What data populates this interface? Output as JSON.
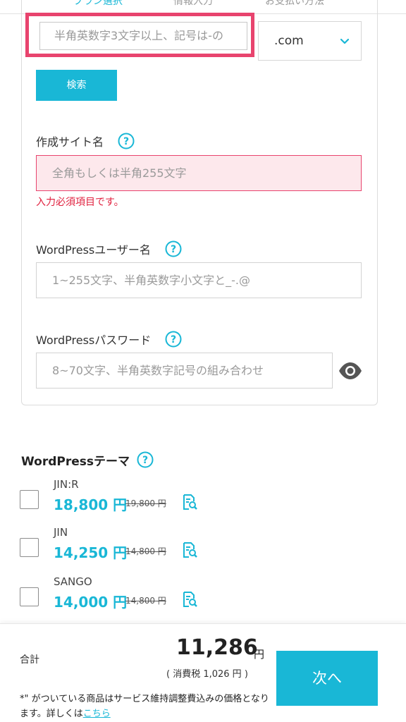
{
  "steps": [
    "プラン選択",
    "情報入力",
    "お支払い方法"
  ],
  "domain": {
    "placeholder": "半角英数字3文字以上、記号は-の",
    "tld": ".com",
    "search_label": "検索"
  },
  "fields": {
    "site_name": {
      "label": "作成サイト名",
      "placeholder": "全角もしくは半角255文字",
      "error": "入力必須項目です。"
    },
    "wp_user": {
      "label": "WordPressユーザー名",
      "placeholder": "1~255文字、半角英数字小文字と_-.@"
    },
    "wp_password": {
      "label": "WordPressパスワード",
      "placeholder": "8~70文字、半角英数字記号の組み合わせ"
    }
  },
  "themes": {
    "title": "WordPressテーマ",
    "items": [
      {
        "name": "JIN:R",
        "price": "18,800 円",
        "old_price": "19,800 円"
      },
      {
        "name": "JIN",
        "price": "14,250 円",
        "old_price": "14,800 円"
      },
      {
        "name": "SANGO",
        "price": "14,000 円",
        "old_price": "14,800 円"
      }
    ]
  },
  "footer": {
    "total_label": "合計",
    "total_price": "11,286",
    "total_unit": "円",
    "tax_note": "( 消費税 1,026 円 )",
    "next_label": "次へ",
    "note_text": "*\" がついている商品はサービス維持調整費込みの価格となります。詳しくは",
    "note_link": "こちら"
  },
  "colors": {
    "accent": "#19b7d6",
    "error": "#e01f3d",
    "highlight": "#e8446e",
    "error_bg": "#fde8ec"
  }
}
